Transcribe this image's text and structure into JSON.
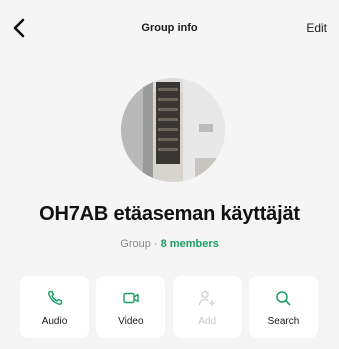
{
  "header": {
    "title": "Group info",
    "edit_label": "Edit"
  },
  "group": {
    "name": "OH7AB etäaseman käyttäjät",
    "type_label": "Group · ",
    "members_label": "8 members"
  },
  "actions": [
    {
      "label": "Audio",
      "icon": "phone-icon",
      "enabled": true
    },
    {
      "label": "Video",
      "icon": "video-icon",
      "enabled": true
    },
    {
      "label": "Add",
      "icon": "add-user-icon",
      "enabled": false
    },
    {
      "label": "Search",
      "icon": "search-icon",
      "enabled": true
    }
  ],
  "colors": {
    "accent": "#1aa064",
    "background": "#f5f5f5",
    "card": "#ffffff"
  }
}
